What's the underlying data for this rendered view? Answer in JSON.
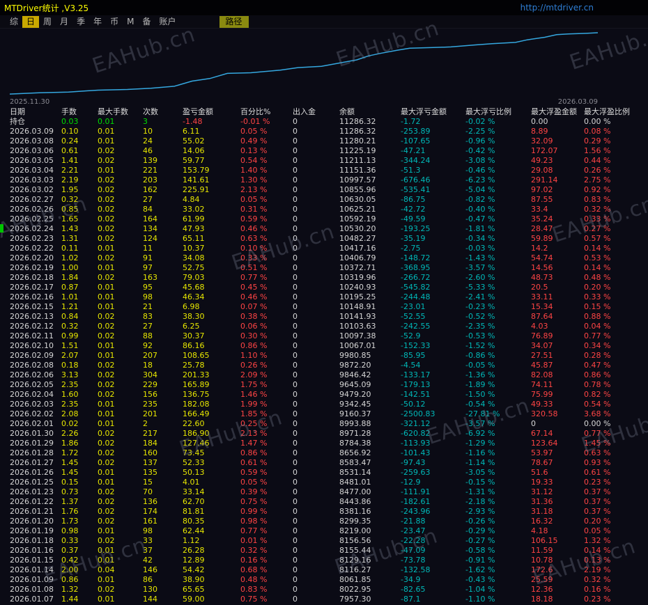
{
  "title_bar": {
    "title": "MTDriver统计 ,V3.25",
    "link": "http://mtdriver.cn"
  },
  "menu": {
    "items": [
      "综",
      "日",
      "周",
      "月",
      "季",
      "年",
      "币",
      "M",
      "备",
      "账户"
    ],
    "active": "日",
    "path_button": "路径"
  },
  "chart": {
    "start_date": "2025.11.30",
    "end_date": "2026.03.09",
    "watermark": "EAHub.cn",
    "line_color": "#35a8e0"
  },
  "chart_data": {
    "type": "line",
    "series_name": "余额",
    "x_start": "2025.11.30",
    "x_end": "2026.03.09",
    "ylim": [
      6100,
      11400
    ],
    "grid": false,
    "points": [
      [
        0.0,
        6210
      ],
      [
        0.05,
        6320
      ],
      [
        0.1,
        6375
      ],
      [
        0.15,
        6530
      ],
      [
        0.2,
        6590
      ],
      [
        0.24,
        6695
      ],
      [
        0.28,
        6855
      ],
      [
        0.31,
        7280
      ],
      [
        0.34,
        7495
      ],
      [
        0.37,
        7920
      ],
      [
        0.41,
        7975
      ],
      [
        0.46,
        8190
      ],
      [
        0.49,
        8400
      ],
      [
        0.53,
        8510
      ],
      [
        0.56,
        8775
      ],
      [
        0.59,
        9040
      ],
      [
        0.61,
        9365
      ],
      [
        0.63,
        9575
      ],
      [
        0.66,
        9845
      ],
      [
        0.68,
        10005
      ],
      [
        0.72,
        10060
      ],
      [
        0.75,
        10110
      ],
      [
        0.79,
        10270
      ],
      [
        0.82,
        10380
      ],
      [
        0.86,
        10485
      ],
      [
        0.88,
        10700
      ],
      [
        0.91,
        10910
      ],
      [
        0.93,
        11125
      ],
      [
        0.95,
        11180
      ],
      [
        0.98,
        11235
      ],
      [
        1.0,
        11286
      ]
    ]
  },
  "table": {
    "headers": [
      "日期",
      "手数",
      "最大手数",
      "次数",
      "盈亏金额",
      "百分比%",
      "出入金",
      "余额",
      "最大浮亏金额",
      "最大浮亏比例",
      "最大浮盈金额",
      "最大浮盈比例"
    ],
    "rows": [
      [
        "持仓",
        "0.03",
        "0.01",
        "3",
        "-1.48",
        "-0.01 %",
        "0",
        "11286.32",
        "-1.72",
        "-0.02 %",
        "0.00",
        "0.00 %"
      ],
      [
        "2026.03.09",
        "0.10",
        "0.01",
        "10",
        "6.11",
        "0.05 %",
        "0",
        "11286.32",
        "-253.89",
        "-2.25 %",
        "8.89",
        "0.08 %"
      ],
      [
        "2026.03.08",
        "0.24",
        "0.01",
        "24",
        "55.02",
        "0.49 %",
        "0",
        "11280.21",
        "-107.65",
        "-0.96 %",
        "32.09",
        "0.29 %"
      ],
      [
        "2026.03.06",
        "0.61",
        "0.02",
        "46",
        "14.06",
        "0.13 %",
        "0",
        "11225.19",
        "-47.21",
        "-0.42 %",
        "172.07",
        "1.56 %"
      ],
      [
        "2026.03.05",
        "1.41",
        "0.02",
        "139",
        "59.77",
        "0.54 %",
        "0",
        "11211.13",
        "-344.24",
        "-3.08 %",
        "49.23",
        "0.44 %"
      ],
      [
        "2026.03.04",
        "2.21",
        "0.01",
        "221",
        "153.79",
        "1.40 %",
        "0",
        "11151.36",
        "-51.3",
        "-0.46 %",
        "29.08",
        "0.26 %"
      ],
      [
        "2026.03.03",
        "2.19",
        "0.02",
        "203",
        "141.61",
        "1.30 %",
        "0",
        "10997.57",
        "-676.46",
        "-6.23 %",
        "291.14",
        "2.75 %"
      ],
      [
        "2026.03.02",
        "1.95",
        "0.02",
        "162",
        "225.91",
        "2.13 %",
        "0",
        "10855.96",
        "-535.41",
        "-5.04 %",
        "97.02",
        "0.92 %"
      ],
      [
        "2026.02.27",
        "0.32",
        "0.02",
        "27",
        "4.84",
        "0.05 %",
        "0",
        "10630.05",
        "-86.75",
        "-0.82 %",
        "87.55",
        "0.83 %"
      ],
      [
        "2026.02.26",
        "0.85",
        "0.02",
        "84",
        "33.02",
        "0.31 %",
        "0",
        "10625.21",
        "-42.72",
        "-0.40 %",
        "33.4",
        "0.32 %"
      ],
      [
        "2026.02.25",
        "1.65",
        "0.02",
        "164",
        "61.99",
        "0.59 %",
        "0",
        "10592.19",
        "-49.59",
        "-0.47 %",
        "35.24",
        "0.33 %"
      ],
      [
        "2026.02.24",
        "1.43",
        "0.02",
        "134",
        "47.93",
        "0.46 %",
        "0",
        "10530.20",
        "-193.25",
        "-1.81 %",
        "28.47",
        "0.27 %"
      ],
      [
        "2026.02.23",
        "1.31",
        "0.02",
        "124",
        "65.11",
        "0.63 %",
        "0",
        "10482.27",
        "-35.19",
        "-0.34 %",
        "59.89",
        "0.57 %"
      ],
      [
        "2026.02.22",
        "0.11",
        "0.01",
        "11",
        "10.37",
        "0.10 %",
        "0",
        "10417.16",
        "-2.75",
        "-0.03 %",
        "14.2",
        "0.14 %"
      ],
      [
        "2026.02.20",
        "1.02",
        "0.02",
        "91",
        "34.08",
        "0.33 %",
        "0",
        "10406.79",
        "-148.72",
        "-1.43 %",
        "54.74",
        "0.53 %"
      ],
      [
        "2026.02.19",
        "1.00",
        "0.01",
        "97",
        "52.75",
        "0.51 %",
        "0",
        "10372.71",
        "-368.95",
        "-3.57 %",
        "14.56",
        "0.14 %"
      ],
      [
        "2026.02.18",
        "1.84",
        "0.02",
        "163",
        "79.03",
        "0.77 %",
        "0",
        "10319.96",
        "-266.72",
        "-2.60 %",
        "48.73",
        "0.48 %"
      ],
      [
        "2026.02.17",
        "0.87",
        "0.01",
        "95",
        "45.68",
        "0.45 %",
        "0",
        "10240.93",
        "-545.82",
        "-5.33 %",
        "20.5",
        "0.20 %"
      ],
      [
        "2026.02.16",
        "1.01",
        "0.01",
        "98",
        "46.34",
        "0.46 %",
        "0",
        "10195.25",
        "-244.48",
        "-2.41 %",
        "33.11",
        "0.33 %"
      ],
      [
        "2026.02.15",
        "1.21",
        "0.01",
        "21",
        "6.98",
        "0.07 %",
        "0",
        "10148.91",
        "-23.01",
        "-0.23 %",
        "15.34",
        "0.15 %"
      ],
      [
        "2026.02.13",
        "0.84",
        "0.02",
        "83",
        "38.30",
        "0.38 %",
        "0",
        "10141.93",
        "-52.55",
        "-0.52 %",
        "87.64",
        "0.88 %"
      ],
      [
        "2026.02.12",
        "0.32",
        "0.02",
        "27",
        "6.25",
        "0.06 %",
        "0",
        "10103.63",
        "-242.55",
        "-2.35 %",
        "4.03",
        "0.04 %"
      ],
      [
        "2026.02.11",
        "0.99",
        "0.02",
        "88",
        "30.37",
        "0.30 %",
        "0",
        "10097.38",
        "-52.9",
        "-0.53 %",
        "76.89",
        "0.77 %"
      ],
      [
        "2026.02.10",
        "1.51",
        "0.01",
        "92",
        "86.16",
        "0.86 %",
        "0",
        "10067.01",
        "-152.33",
        "-1.52 %",
        "34.07",
        "0.34 %"
      ],
      [
        "2026.02.09",
        "2.07",
        "0.01",
        "207",
        "108.65",
        "1.10 %",
        "0",
        "9980.85",
        "-85.95",
        "-0.86 %",
        "27.51",
        "0.28 %"
      ],
      [
        "2026.02.08",
        "0.18",
        "0.02",
        "18",
        "25.78",
        "0.26 %",
        "0",
        "9872.20",
        "-4.54",
        "-0.05 %",
        "45.87",
        "0.47 %"
      ],
      [
        "2026.02.06",
        "3.13",
        "0.02",
        "304",
        "201.33",
        "2.09 %",
        "0",
        "9846.42",
        "-133.17",
        "-1.36 %",
        "82.08",
        "0.86 %"
      ],
      [
        "2026.02.05",
        "2.35",
        "0.02",
        "229",
        "165.89",
        "1.75 %",
        "0",
        "9645.09",
        "-179.13",
        "-1.89 %",
        "74.11",
        "0.78 %"
      ],
      [
        "2026.02.04",
        "1.60",
        "0.02",
        "156",
        "136.75",
        "1.46 %",
        "0",
        "9479.20",
        "-142.51",
        "-1.50 %",
        "75.99",
        "0.82 %"
      ],
      [
        "2026.02.03",
        "2.35",
        "0.01",
        "235",
        "182.08",
        "1.99 %",
        "0",
        "9342.45",
        "-50.12",
        "-0.54 %",
        "49.33",
        "0.54 %"
      ],
      [
        "2026.02.02",
        "2.08",
        "0.01",
        "201",
        "166.49",
        "1.85 %",
        "0",
        "9160.37",
        "-2500.83",
        "-27.81 %",
        "320.58",
        "3.68 %"
      ],
      [
        "2026.02.01",
        "0.02",
        "0.01",
        "2",
        "22.60",
        "0.25 %",
        "0",
        "8993.88",
        "-321.12",
        "-3.57 %",
        "0",
        "0.00 %"
      ],
      [
        "2026.01.30",
        "2.26",
        "0.02",
        "217",
        "186.90",
        "2.13 %",
        "0",
        "8971.28",
        "-620.82",
        "-6.92 %",
        "67.14",
        "0.77 %"
      ],
      [
        "2026.01.29",
        "1.86",
        "0.02",
        "184",
        "127.46",
        "1.47 %",
        "0",
        "8784.38",
        "-113.93",
        "-1.29 %",
        "123.64",
        "1.45 %"
      ],
      [
        "2026.01.28",
        "1.72",
        "0.02",
        "160",
        "73.45",
        "0.86 %",
        "0",
        "8656.92",
        "-101.43",
        "-1.16 %",
        "53.97",
        "0.63 %"
      ],
      [
        "2026.01.27",
        "1.45",
        "0.02",
        "137",
        "52.33",
        "0.61 %",
        "0",
        "8583.47",
        "-97.43",
        "-1.14 %",
        "78.67",
        "0.93 %"
      ],
      [
        "2026.01.26",
        "1.45",
        "0.01",
        "135",
        "50.13",
        "0.59 %",
        "0",
        "8531.14",
        "-259.63",
        "-3.05 %",
        "51.6",
        "0.61 %"
      ],
      [
        "2026.01.25",
        "0.15",
        "0.01",
        "15",
        "4.01",
        "0.05 %",
        "0",
        "8481.01",
        "-12.9",
        "-0.15 %",
        "19.33",
        "0.23 %"
      ],
      [
        "2026.01.23",
        "0.73",
        "0.02",
        "70",
        "33.14",
        "0.39 %",
        "0",
        "8477.00",
        "-111.91",
        "-1.31 %",
        "31.12",
        "0.37 %"
      ],
      [
        "2026.01.22",
        "1.37",
        "0.02",
        "136",
        "62.70",
        "0.75 %",
        "0",
        "8443.86",
        "-182.61",
        "-2.18 %",
        "31.36",
        "0.37 %"
      ],
      [
        "2026.01.21",
        "1.76",
        "0.02",
        "174",
        "81.81",
        "0.99 %",
        "0",
        "8381.16",
        "-243.96",
        "-2.93 %",
        "31.18",
        "0.37 %"
      ],
      [
        "2026.01.20",
        "1.73",
        "0.02",
        "161",
        "80.35",
        "0.98 %",
        "0",
        "8299.35",
        "-21.88",
        "-0.26 %",
        "16.32",
        "0.20 %"
      ],
      [
        "2026.01.19",
        "0.98",
        "0.01",
        "98",
        "62.44",
        "0.77 %",
        "0",
        "8219.00",
        "-23.47",
        "-0.29 %",
        "4.18",
        "0.05 %"
      ],
      [
        "2026.01.18",
        "0.33",
        "0.02",
        "33",
        "1.12",
        "0.01 %",
        "0",
        "8156.56",
        "-22.28",
        "-0.27 %",
        "106.15",
        "1.32 %"
      ],
      [
        "2026.01.16",
        "0.37",
        "0.01",
        "37",
        "26.28",
        "0.32 %",
        "0",
        "8155.44",
        "-47.09",
        "-0.58 %",
        "11.59",
        "0.14 %"
      ],
      [
        "2026.01.15",
        "0.42",
        "0.01",
        "42",
        "12.89",
        "0.16 %",
        "0",
        "8129.16",
        "-73.78",
        "-0.91 %",
        "10.78",
        "0.13 %"
      ],
      [
        "2026.01.14",
        "2.00",
        "0.04",
        "146",
        "54.42",
        "0.68 %",
        "0",
        "8116.27",
        "-132.58",
        "-1.62 %",
        "172.6",
        "2.19 %"
      ],
      [
        "2026.01.09",
        "0.86",
        "0.01",
        "86",
        "38.90",
        "0.48 %",
        "0",
        "8061.85",
        "-34.9",
        "-0.43 %",
        "25.59",
        "0.32 %"
      ],
      [
        "2026.01.08",
        "1.32",
        "0.02",
        "130",
        "65.65",
        "0.83 %",
        "0",
        "8022.95",
        "-82.65",
        "-1.04 %",
        "12.36",
        "0.16 %"
      ],
      [
        "2026.01.07",
        "1.44",
        "0.01",
        "144",
        "59.00",
        "0.75 %",
        "0",
        "7957.30",
        "-87.1",
        "-1.10 %",
        "18.18",
        "0.23 %"
      ]
    ]
  }
}
